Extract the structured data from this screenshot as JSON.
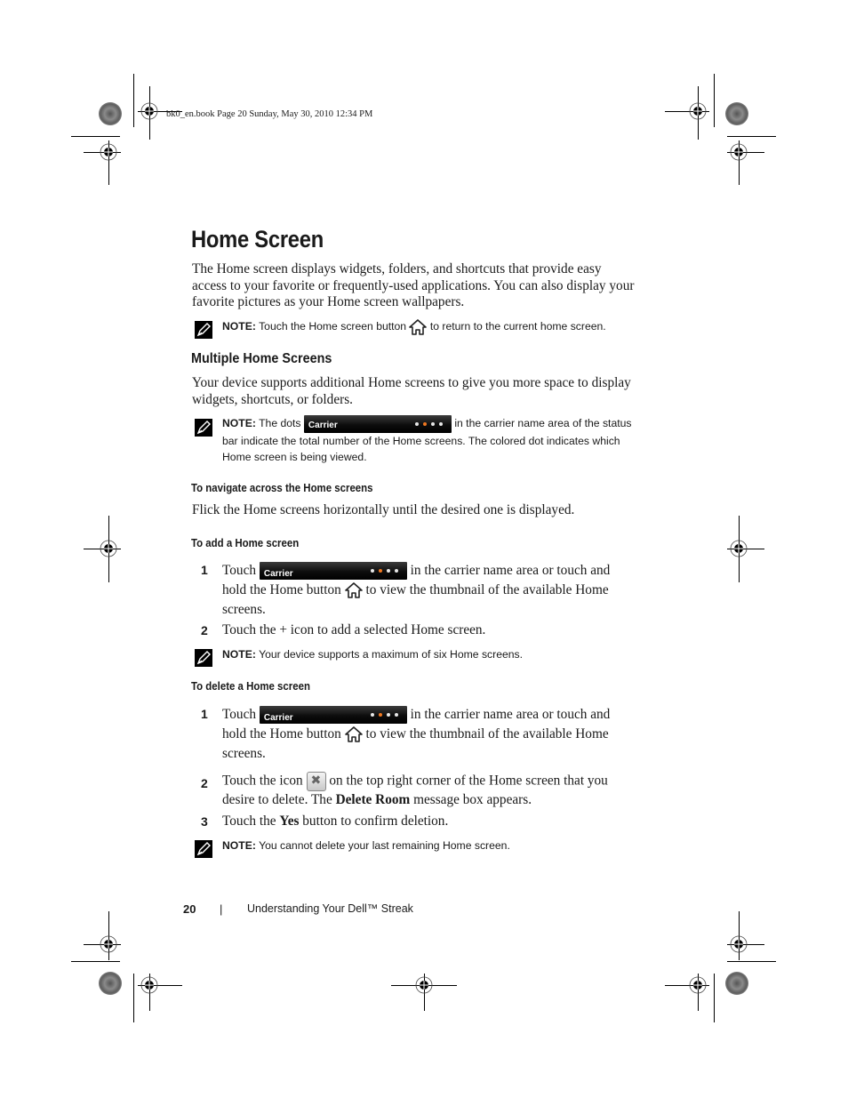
{
  "print_header": "bk0_en.book  Page 20  Sunday, May 30, 2010  12:34 PM",
  "title": "Home Screen",
  "intro": "The Home screen displays widgets, folders, and shortcuts that provide easy access to your favorite or frequently-used applications. You can also display your favorite pictures as your Home screen wallpapers.",
  "note_label": "NOTE:",
  "note1": {
    "before": "Touch the Home screen button",
    "after": "to return to the current home screen."
  },
  "section": {
    "title": "Multiple Home Screens",
    "intro": "Your device supports additional Home screens to give you more space to display widgets, shortcuts, or folders."
  },
  "note2": {
    "before": "The dots",
    "after": "in the carrier name area of the status bar indicate the total number of the Home screens. The colored dot indicates which Home screen is being viewed."
  },
  "carrier_bar": {
    "label": "Carrier",
    "dot_count": 4,
    "active_dot_index": 1,
    "active_color": "#f07820"
  },
  "navigate": {
    "title": "To navigate across the Home screens",
    "text": "Flick the Home screens horizontally until the desired one is displayed."
  },
  "add": {
    "title": "To add a Home screen",
    "steps": [
      {
        "num": "1",
        "before": "Touch",
        "mid": "in the carrier name area or touch and hold the Home button",
        "after": "to view the thumbnail of the available Home screens."
      },
      {
        "num": "2",
        "text": "Touch the + icon to add a selected Home screen."
      }
    ],
    "note": "Your device supports a maximum of six Home screens."
  },
  "delete": {
    "title": "To delete a Home screen",
    "steps": [
      {
        "num": "1",
        "before": "Touch",
        "mid": "in the carrier name area or touch and hold the Home button",
        "after": "to view the thumbnail of the available Home screens."
      },
      {
        "num": "2",
        "before": "Touch the icon",
        "after": "on the top right corner of the Home screen that you desire to delete. The",
        "bold": "Delete Room",
        "end": "message box appears."
      },
      {
        "num": "3",
        "before": "Touch the",
        "bold": "Yes",
        "after": "button to confirm deletion."
      }
    ],
    "note": "You cannot delete your last remaining Home screen."
  },
  "footer": {
    "page_number": "20",
    "separator": "|",
    "chapter": "Understanding Your Dell™ Streak"
  }
}
